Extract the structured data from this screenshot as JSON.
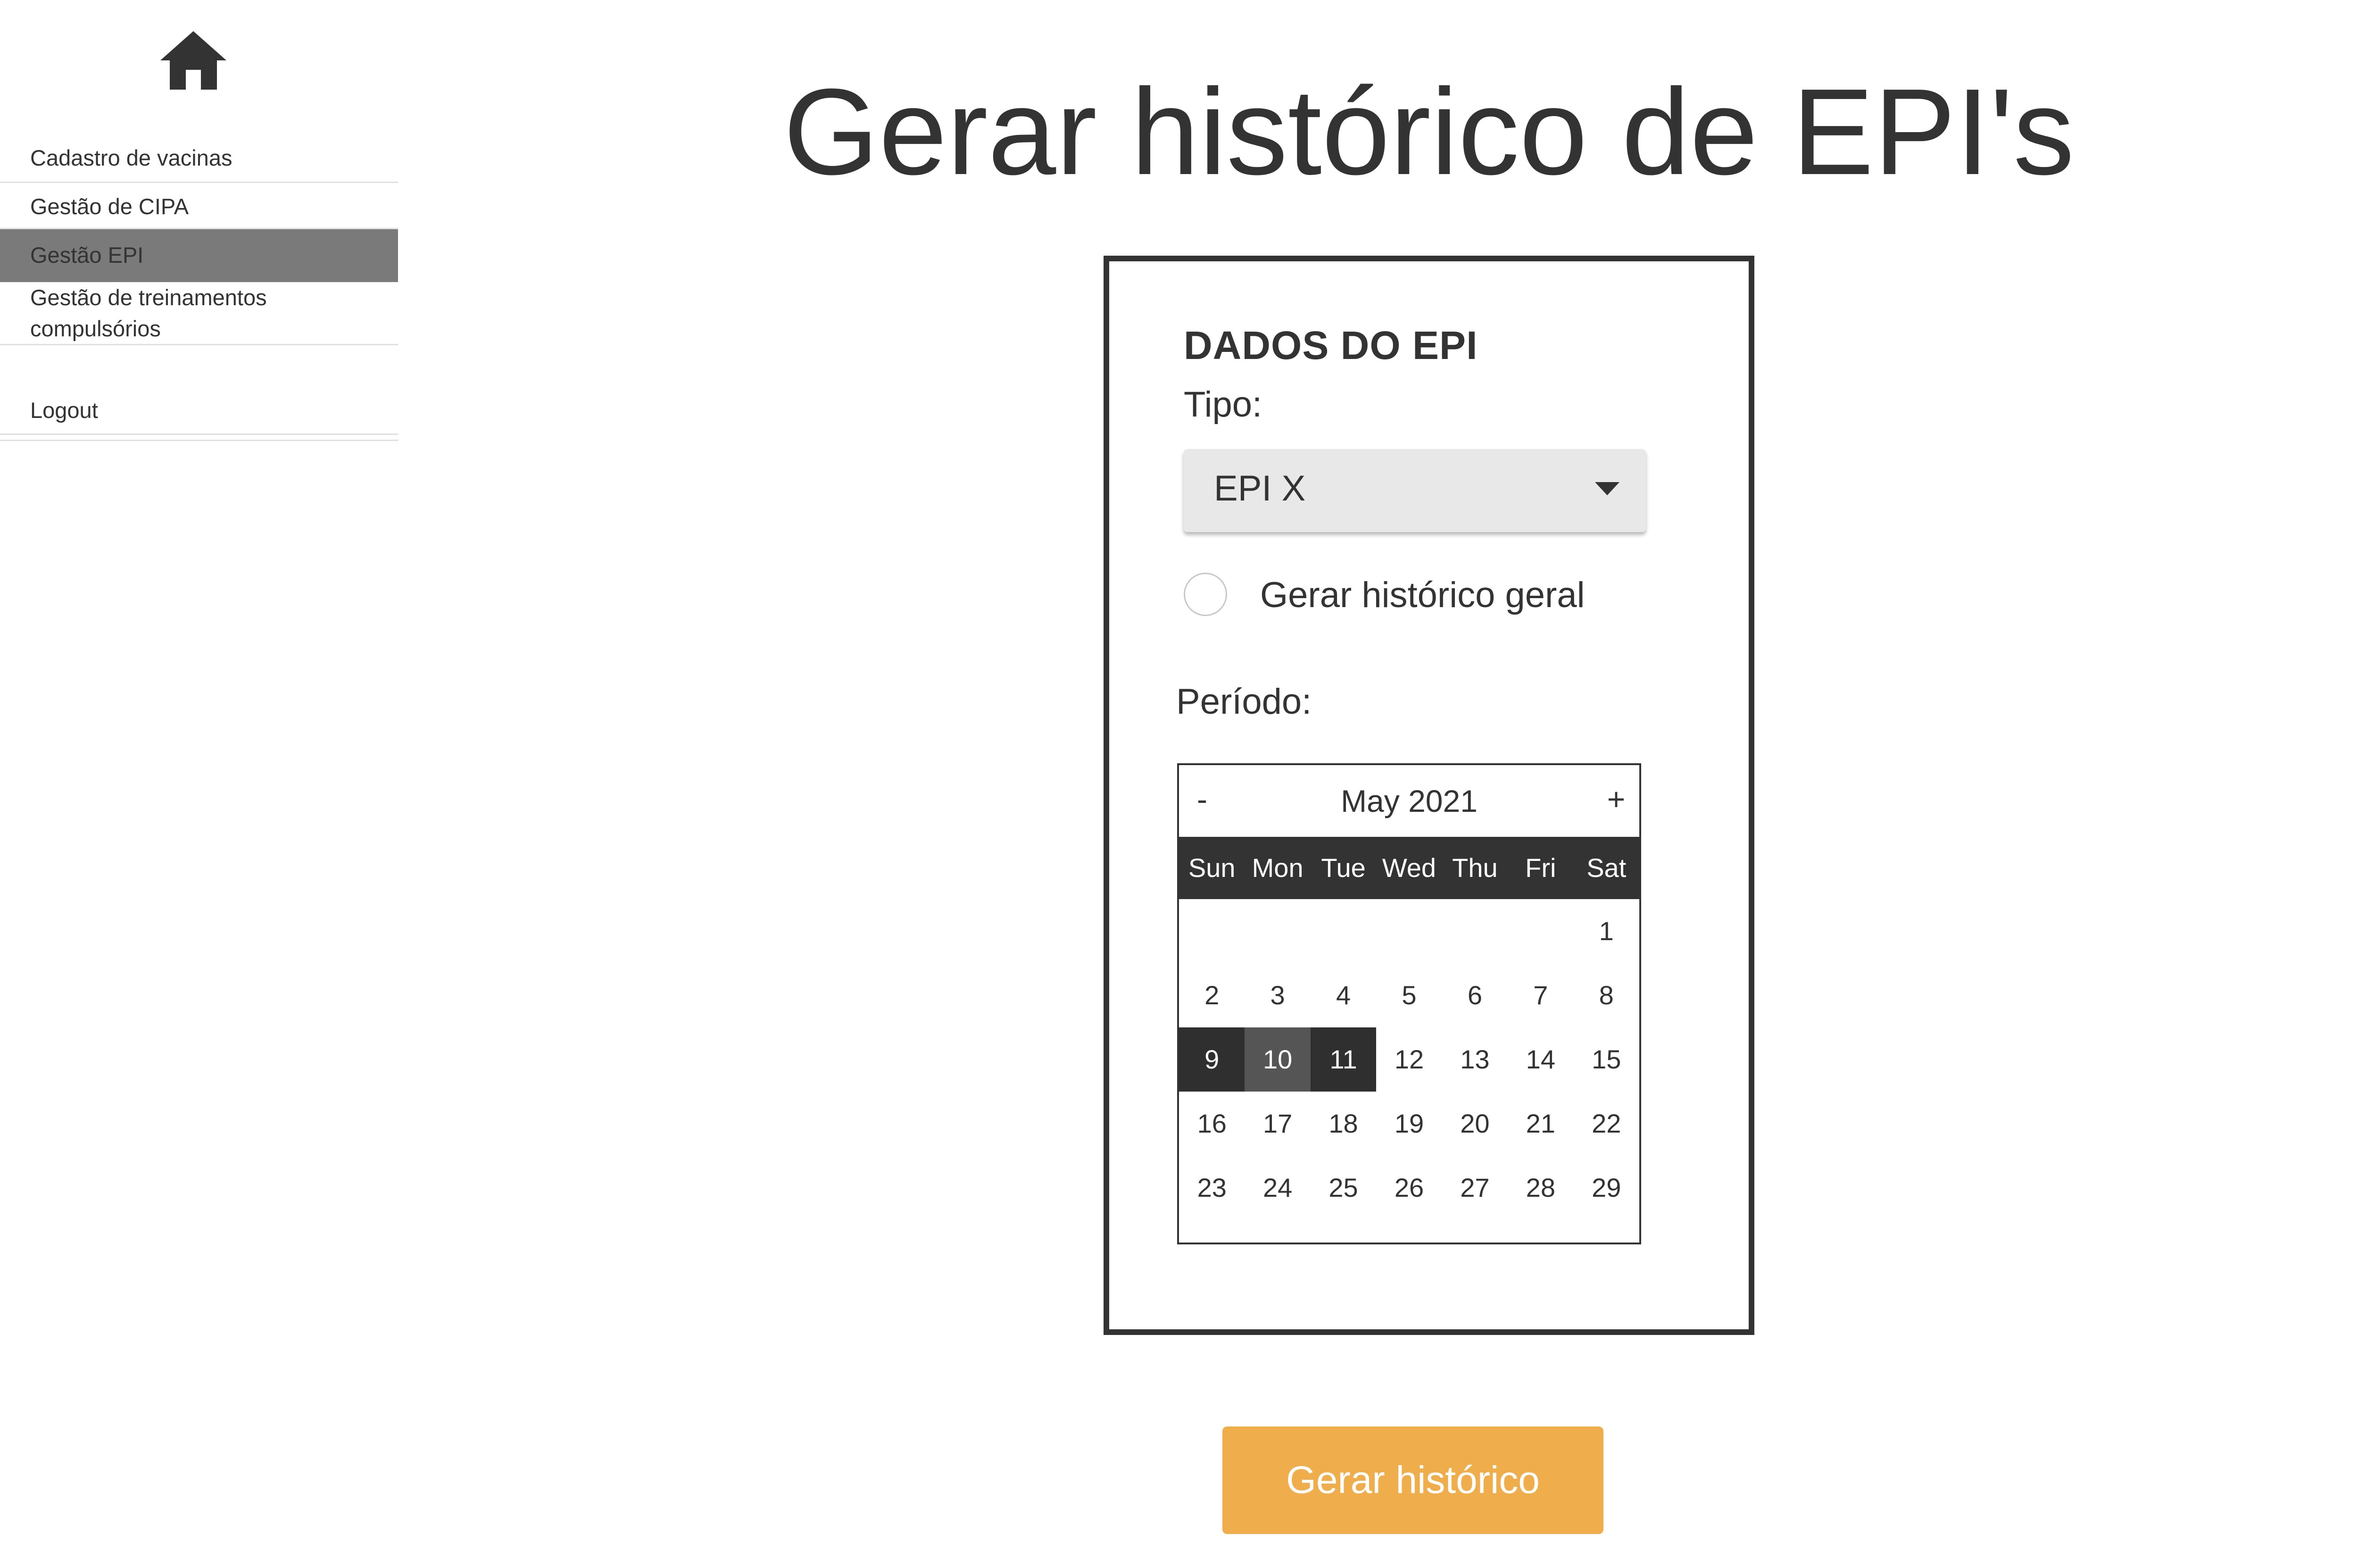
{
  "sidebar": {
    "home_icon": "home-icon",
    "items": [
      {
        "label": "Cadastro de vacinas",
        "active": false
      },
      {
        "label": "Gestão de CIPA",
        "active": false
      },
      {
        "label": "Gestão EPI",
        "active": true
      },
      {
        "label": "Gestão de treinamentos compulsórios",
        "active": false
      },
      {
        "label": "Logout",
        "active": false
      }
    ],
    "active_color": "#7a7a7a"
  },
  "page": {
    "title": "Gerar histórico de EPI's"
  },
  "form": {
    "title": "DADOS DO EPI",
    "tipo_label": "Tipo:",
    "tipo_value": "EPI X",
    "radio_label": "Gerar histórico geral",
    "radio_checked": false,
    "periodo_label": "Período:"
  },
  "calendar": {
    "prev": "-",
    "next": "+",
    "month": "May 2021",
    "weekdays": [
      "Sun",
      "Mon",
      "Tue",
      "Wed",
      "Thu",
      "Fri",
      "Sat"
    ],
    "days": [
      "",
      "",
      "",
      "",
      "",
      "",
      "1",
      "2",
      "3",
      "4",
      "5",
      "6",
      "7",
      "8",
      "9",
      "10",
      "11",
      "12",
      "13",
      "14",
      "15",
      "16",
      "17",
      "18",
      "19",
      "20",
      "21",
      "22",
      "23",
      "24",
      "25",
      "26",
      "27",
      "28",
      "29"
    ],
    "range_start": "9",
    "range_end": "11"
  },
  "button": {
    "label": "Gerar histórico",
    "color": "#efad4c"
  }
}
